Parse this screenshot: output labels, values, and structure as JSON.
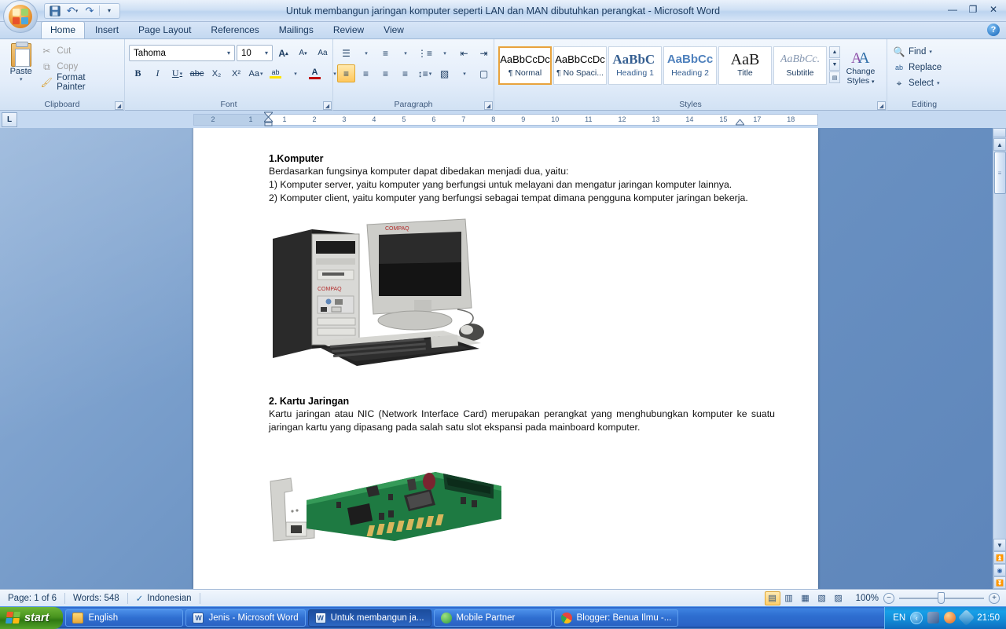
{
  "window": {
    "title": "Untuk membangun jaringan komputer seperti LAN dan MAN dibutuhkan perangkat - Microsoft Word",
    "minimize_label": "—",
    "maximize_label": "❐",
    "close_label": "✕",
    "help_label": "?"
  },
  "quick_access": {
    "save_icon": "save-icon",
    "undo_icon": "undo-icon",
    "redo_icon": "redo-icon",
    "customize_icon": "chevron-down-icon"
  },
  "tabs": [
    {
      "label": "Home",
      "active": true
    },
    {
      "label": "Insert",
      "active": false
    },
    {
      "label": "Page Layout",
      "active": false
    },
    {
      "label": "References",
      "active": false
    },
    {
      "label": "Mailings",
      "active": false
    },
    {
      "label": "Review",
      "active": false
    },
    {
      "label": "View",
      "active": false
    }
  ],
  "ribbon": {
    "clipboard": {
      "label": "Clipboard",
      "paste_label": "Paste",
      "commands": [
        {
          "label": "Cut",
          "icon": "scissors-icon",
          "enabled": false
        },
        {
          "label": "Copy",
          "icon": "copy-icon",
          "enabled": false
        },
        {
          "label": "Format Painter",
          "icon": "paintbrush-icon",
          "enabled": true
        }
      ]
    },
    "font": {
      "label": "Font",
      "font_name": "Tahoma",
      "font_size": "10",
      "grow_font": "A",
      "shrink_font": "A",
      "clear_formatting": "Aa",
      "bold": "B",
      "italic": "I",
      "underline": "U",
      "strikethrough": "abc",
      "subscript": "X₂",
      "superscript": "X²",
      "change_case": "Aa",
      "highlight": "ab",
      "font_color": "A"
    },
    "paragraph": {
      "label": "Paragraph",
      "bullets": "bullets-icon",
      "numbering": "numbering-icon",
      "multilevel": "multilevel-list-icon",
      "decrease_indent": "decrease-indent-icon",
      "increase_indent": "increase-indent-icon",
      "sort": "sort-icon",
      "show_marks": "¶",
      "align_left": "align-left-icon",
      "align_center": "align-center-icon",
      "align_right": "align-right-icon",
      "justify": "justify-icon",
      "line_spacing": "line-spacing-icon",
      "shading": "shading-icon",
      "borders": "borders-icon"
    },
    "styles": {
      "label": "Styles",
      "change_styles_label": "Change\nStyles",
      "items": [
        {
          "preview": "AaBbCcDc",
          "name": "¶ Normal",
          "selected": true
        },
        {
          "preview": "AaBbCcDc",
          "name": "¶ No Spaci...",
          "selected": false
        },
        {
          "preview": "AaBbC ",
          "name": "Heading 1",
          "selected": false
        },
        {
          "preview": "AaBbCc",
          "name": "Heading 2",
          "selected": false
        },
        {
          "preview": "AaB",
          "name": "Title",
          "selected": false
        },
        {
          "preview": "AaBbCc.",
          "name": "Subtitle",
          "selected": false
        }
      ]
    },
    "editing": {
      "label": "Editing",
      "commands": [
        {
          "label": "Find",
          "icon": "binoculars-icon",
          "has_caret": true
        },
        {
          "label": "Replace",
          "icon": "replace-icon",
          "has_caret": false
        },
        {
          "label": "Select",
          "icon": "select-arrow-icon",
          "has_caret": true
        }
      ]
    }
  },
  "ruler": {
    "tab_stop_marker": "L",
    "left_marks": [
      "2",
      "1"
    ],
    "marks": [
      "1",
      "2",
      "3",
      "4",
      "5",
      "6",
      "7",
      "8",
      "9",
      "10",
      "11",
      "12",
      "13",
      "14",
      "15",
      "17",
      "18"
    ]
  },
  "document": {
    "blocks": [
      {
        "type": "heading",
        "text": "1.Komputer"
      },
      {
        "type": "para",
        "text": "Berdasarkan fungsinya komputer dapat dibedakan menjadi dua, yaitu:"
      },
      {
        "type": "para",
        "text": "1) Komputer server, yaitu komputer yang berfungsi untuk melayani dan mengatur jaringan komputer lainnya."
      },
      {
        "type": "para",
        "text": "2) Komputer client, yaitu komputer yang berfungsi sebagai tempat dimana pengguna komputer jaringan bekerja."
      },
      {
        "type": "image",
        "alt": "desktop-computer-photo"
      },
      {
        "type": "heading",
        "text": "2. Kartu Jaringan"
      },
      {
        "type": "para",
        "text": "Kartu jaringan atau NIC (Network Interface Card) merupakan perangkat yang menghubungkan komputer ke suatu jaringan kartu yang dipasang pada salah satu slot ekspansi pada mainboard komputer."
      },
      {
        "type": "image",
        "alt": "network-interface-card-photo"
      }
    ]
  },
  "status_bar": {
    "page": "Page: 1 of 6",
    "words": "Words: 548",
    "proofing_icon": "spell-check-icon",
    "language": "Indonesian",
    "views": [
      {
        "name": "print-layout",
        "glyph": "▤",
        "active": true
      },
      {
        "name": "full-screen-reading",
        "glyph": "▥",
        "active": false
      },
      {
        "name": "web-layout",
        "glyph": "▦",
        "active": false
      },
      {
        "name": "outline",
        "glyph": "▧",
        "active": false
      },
      {
        "name": "draft",
        "glyph": "▨",
        "active": false
      }
    ],
    "zoom": "100%",
    "zoom_out": "−",
    "zoom_in": "+"
  },
  "taskbar": {
    "start_label": "start",
    "buttons": [
      {
        "label": "English",
        "icon": "folder-icon",
        "color": "#f6c555",
        "active": false
      },
      {
        "label": "Jenis - Microsoft Word",
        "icon": "word-icon",
        "color": "#2b579a",
        "active": false
      },
      {
        "label": "Untuk membangun ja...",
        "icon": "word-icon",
        "color": "#2b579a",
        "active": true
      },
      {
        "label": "Mobile Partner",
        "icon": "mobile-partner-icon",
        "color": "#2f9e3f",
        "active": false
      },
      {
        "label": "Blogger: Benua Ilmu -...",
        "icon": "chrome-icon",
        "color": "#e8453c",
        "active": false
      }
    ],
    "tray": {
      "language": "EN",
      "chevron": "‹",
      "icons": [
        "network-icon",
        "orange-app-icon",
        "dropbox-icon"
      ],
      "clock": "21:50"
    }
  }
}
